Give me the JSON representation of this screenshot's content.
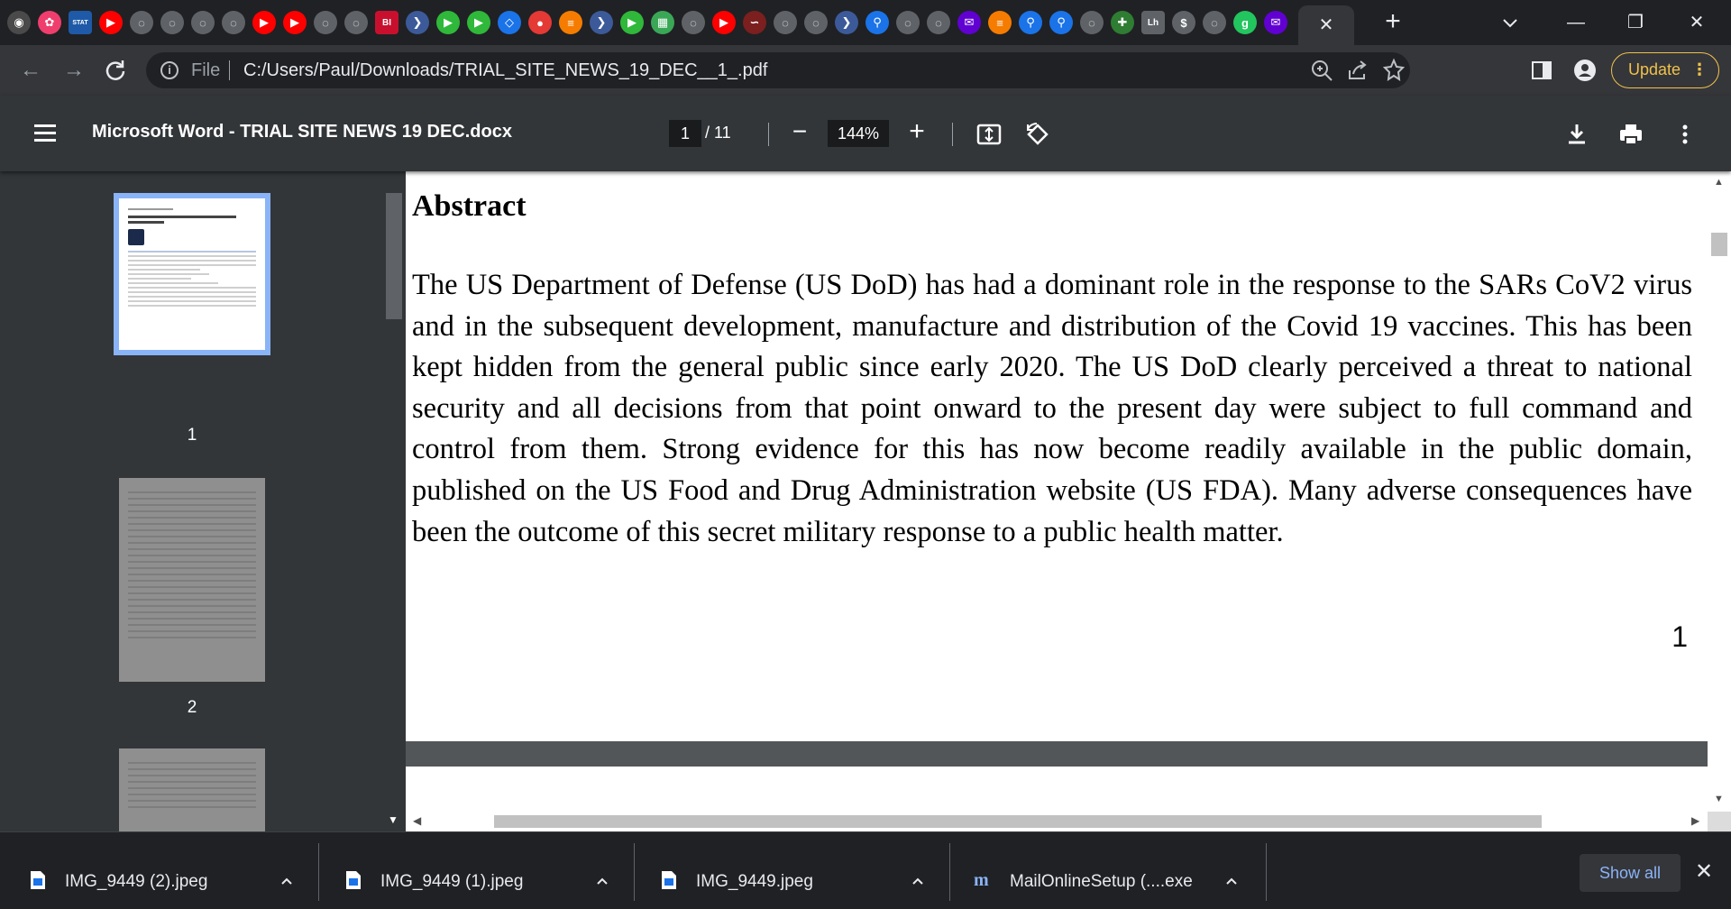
{
  "browser": {
    "tab_favicons": [
      {
        "name": "globe-icon",
        "color": "#4a4a4a",
        "glyph": "◉"
      },
      {
        "name": "pinwheel-icon",
        "color": "#ef3e6d",
        "glyph": "✿"
      },
      {
        "name": "stat-icon",
        "color": "#1e5aa8",
        "glyph": "STAT"
      },
      {
        "name": "youtube-icon",
        "color": "#ff0000",
        "glyph": "▶"
      },
      {
        "name": "globe-icon",
        "color": "#5f6368",
        "glyph": "◌"
      },
      {
        "name": "globe-icon",
        "color": "#5f6368",
        "glyph": "◌"
      },
      {
        "name": "globe-icon",
        "color": "#5f6368",
        "glyph": "◌"
      },
      {
        "name": "globe-icon",
        "color": "#5f6368",
        "glyph": "◌"
      },
      {
        "name": "youtube-icon",
        "color": "#ff0000",
        "glyph": "▶"
      },
      {
        "name": "youtube-icon",
        "color": "#ff0000",
        "glyph": "▶"
      },
      {
        "name": "globe-icon",
        "color": "#5f6368",
        "glyph": "◌"
      },
      {
        "name": "globe-icon",
        "color": "#5f6368",
        "glyph": "◌"
      },
      {
        "name": "bi-icon",
        "color": "#c8102e",
        "glyph": "BI"
      },
      {
        "name": "forward-icon",
        "color": "#3c5a99",
        "glyph": "❯"
      },
      {
        "name": "play-icon",
        "color": "#2fb83a",
        "glyph": "▶"
      },
      {
        "name": "play-icon",
        "color": "#2fb83a",
        "glyph": "▶"
      },
      {
        "name": "shield-icon",
        "color": "#1a73e8",
        "glyph": "◇"
      },
      {
        "name": "mic-icon",
        "color": "#e53935",
        "glyph": "●"
      },
      {
        "name": "bookmark-icon",
        "color": "#f57c00",
        "glyph": "≡"
      },
      {
        "name": "forward-icon",
        "color": "#3c5a99",
        "glyph": "❯"
      },
      {
        "name": "play-icon",
        "color": "#2fb83a",
        "glyph": "▶"
      },
      {
        "name": "image-icon",
        "color": "#3aa757",
        "glyph": "▦"
      },
      {
        "name": "globe-icon",
        "color": "#5f6368",
        "glyph": "◌"
      },
      {
        "name": "youtube-icon",
        "color": "#ff0000",
        "glyph": "▶"
      },
      {
        "name": "signature-icon",
        "color": "#7b1f1f",
        "glyph": "∽"
      },
      {
        "name": "globe-icon",
        "color": "#5f6368",
        "glyph": "◌"
      },
      {
        "name": "globe-icon",
        "color": "#5f6368",
        "glyph": "◌"
      },
      {
        "name": "forward-icon",
        "color": "#3c5a99",
        "glyph": "❯"
      },
      {
        "name": "search-icon",
        "color": "#1a73e8",
        "glyph": "⚲"
      },
      {
        "name": "globe-icon",
        "color": "#5f6368",
        "glyph": "◌"
      },
      {
        "name": "globe-icon",
        "color": "#5f6368",
        "glyph": "◌"
      },
      {
        "name": "mail-icon",
        "color": "#6001d2",
        "glyph": "✉"
      },
      {
        "name": "bookmark-icon",
        "color": "#f57c00",
        "glyph": "≡"
      },
      {
        "name": "search-icon",
        "color": "#1a73e8",
        "glyph": "⚲"
      },
      {
        "name": "search-icon",
        "color": "#1a73e8",
        "glyph": "⚲"
      },
      {
        "name": "globe-icon",
        "color": "#5f6368",
        "glyph": "◌"
      },
      {
        "name": "medical-icon",
        "color": "#2e7d32",
        "glyph": "✚"
      },
      {
        "name": "lh-icon",
        "color": "#5f6368",
        "glyph": "Lh"
      },
      {
        "name": "dollar-icon",
        "color": "#5f6368",
        "glyph": "$"
      },
      {
        "name": "globe-icon",
        "color": "#5f6368",
        "glyph": "◌"
      },
      {
        "name": "g-icon",
        "color": "#22c55e",
        "glyph": "g"
      },
      {
        "name": "mail-icon",
        "color": "#6001d2",
        "glyph": "✉"
      }
    ],
    "url_scheme": "File",
    "url": "C:/Users/Paul/Downloads/TRIAL_SITE_NEWS_19_DEC__1_.pdf",
    "update_label": "Update"
  },
  "viewer": {
    "title": "Microsoft Word - TRIAL SITE NEWS 19 DEC.docx",
    "current_page": "1",
    "total_pages": "/ 11",
    "zoom": "144%"
  },
  "sidebar": {
    "thumbnails": [
      {
        "number": "1"
      },
      {
        "number": "2"
      }
    ]
  },
  "document": {
    "heading": "Abstract",
    "body": "The US Department of Defense (US DoD) has had a dominant role in the response to the SARs CoV2 virus and in the subsequent development, manufacture and distribution of the Covid 19 vaccines. This has been kept hidden from the general public since early 2020. The US DoD clearly perceived a threat to national security and all decisions from that point onward to the present day were subject to full command and control from them. Strong evidence for this has now become readily available in the public domain, published on the US Food and Drug Administration website (US FDA). Many adverse consequences have been the outcome of this secret military response to a public health matter.",
    "page_number": "1"
  },
  "downloads": {
    "items": [
      {
        "name": "IMG_9449 (2).jpeg"
      },
      {
        "name": "IMG_9449 (1).jpeg"
      },
      {
        "name": "IMG_9449.jpeg"
      },
      {
        "name": "MailOnlineSetup (....exe"
      }
    ],
    "show_all_label": "Show all"
  },
  "colors": {
    "accent": "#8ab4f8",
    "update": "#f0c14b",
    "viewer_header": "#323639",
    "viewer_bg": "#525659"
  }
}
